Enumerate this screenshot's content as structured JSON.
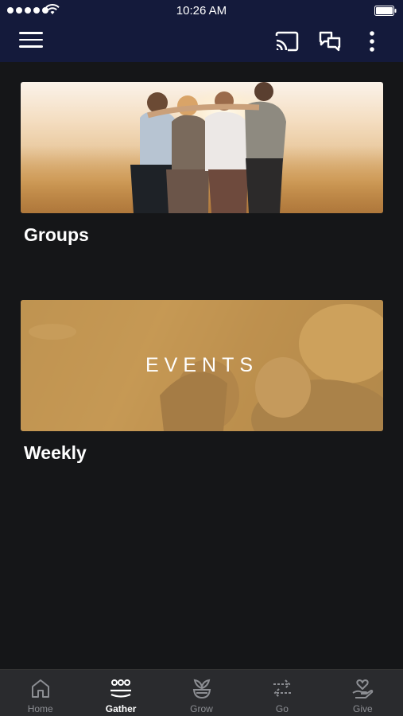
{
  "status_bar": {
    "time": "10:26 AM"
  },
  "nav": {
    "menu_icon": "hamburger-menu-icon",
    "cast_icon": "cast-icon",
    "chat_icon": "chat-bubbles-icon",
    "more_icon": "more-vertical-icon"
  },
  "cards": [
    {
      "title": "Groups",
      "image": "group-of-friends-sunset-photo"
    },
    {
      "title": "Weekly",
      "image": "events-banner-photo",
      "banner_text": "EVENTS"
    }
  ],
  "tabs": [
    {
      "label": "Home",
      "icon": "home-icon",
      "active": false
    },
    {
      "label": "Gather",
      "icon": "people-group-icon",
      "active": true
    },
    {
      "label": "Grow",
      "icon": "plant-icon",
      "active": false
    },
    {
      "label": "Go",
      "icon": "arrows-exchange-icon",
      "active": false
    },
    {
      "label": "Give",
      "icon": "heart-hand-icon",
      "active": false
    }
  ],
  "colors": {
    "nav_background": "#141a3b",
    "page_background": "#151618",
    "tabbar_background": "#2a2b2e",
    "tab_inactive": "#8c8e93",
    "tab_active": "#ffffff"
  }
}
